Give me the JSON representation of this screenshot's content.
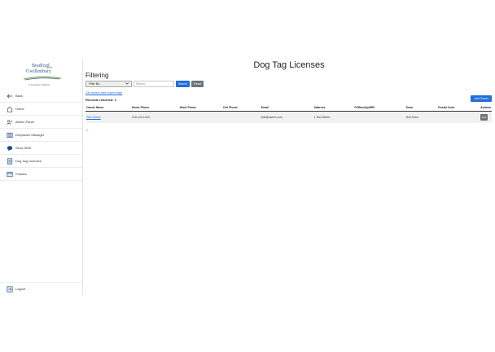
{
  "sidebar": {
    "logo": {
      "line1": "Bradford",
      "line2": "Gwillimbury",
      "line3": "West",
      "tagline": "A Growing Tradition"
    },
    "back_label": "Back",
    "items": [
      {
        "label": "Home",
        "icon": "home-icon"
      },
      {
        "label": "Admin Panel",
        "icon": "users-icon"
      },
      {
        "label": "Dropdown Manager",
        "icon": "list-icon"
      },
      {
        "label": "Send SMS",
        "icon": "chat-icon"
      },
      {
        "label": "Dog Tag Licenses",
        "icon": "document-icon"
      },
      {
        "label": "Policies",
        "icon": "policy-icon"
      }
    ],
    "logout_label": "Logout"
  },
  "main": {
    "title": "Dog Tag Licenses",
    "filter_title": "Filtering",
    "filter_select": "Filter By...",
    "search_placeholder": "Search...",
    "search_button": "Search",
    "reset_button": "Reset",
    "export_link": "Get owners with expired tags",
    "records_returned": "Records returned: 1",
    "add_owner_button": "Add Owner",
    "table": {
      "headers": [
        "Owner Name",
        "Home Phone",
        "Work Phone",
        "Cell Phone",
        "Email",
        "Address",
        "POBox/Apt/RR",
        "Town",
        "Postal Code",
        "Actions"
      ],
      "rows": [
        {
          "owner": "Test Owner",
          "home": "123-123-1234",
          "work": "",
          "cell": "",
          "email": "test@owner.com",
          "address": "1 Test Street",
          "pobox": "",
          "town": "Test Town",
          "postal": "",
          "action": "Edit"
        }
      ]
    },
    "pagination": "1"
  },
  "colors": {
    "accent": "#1f6fd6",
    "secondary": "#6c757d"
  }
}
